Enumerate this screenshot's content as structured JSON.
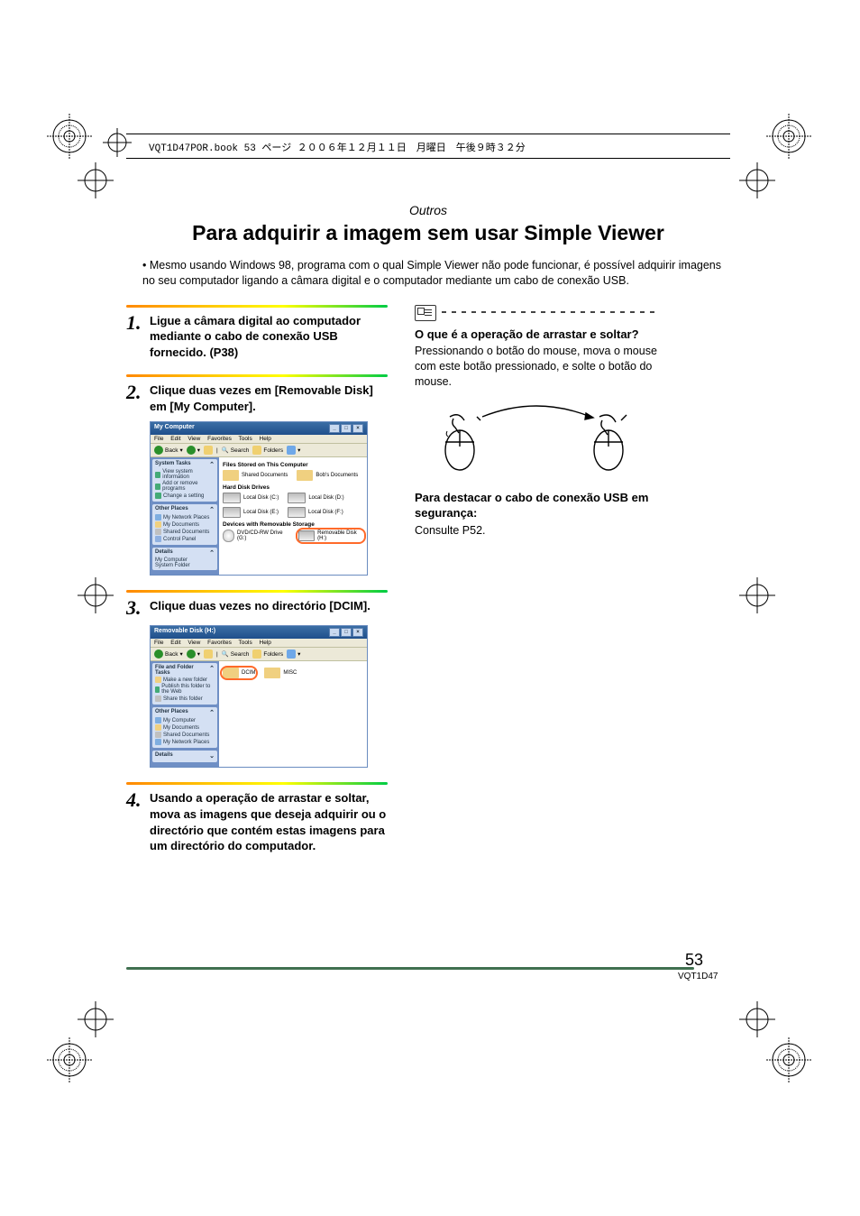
{
  "header_info": "VQT1D47POR.book  53 ページ  ２００６年１２月１１日　月曜日　午後９時３２分",
  "section_header": "Outros",
  "main_title": "Para adquirir a imagem sem usar Simple Viewer",
  "intro_text": "Mesmo usando Windows 98, programa com o qual Simple Viewer não pode funcionar, é possível adquirir imagens no seu computador ligando a câmara digital e o computador mediante um cabo de conexão USB.",
  "steps": [
    {
      "num": "1.",
      "text": "Ligue a câmara digital ao computador mediante o cabo de conexão USB fornecido. (P38)"
    },
    {
      "num": "2.",
      "text": "Clique duas vezes em [Removable Disk] em [My Computer]."
    },
    {
      "num": "3.",
      "text": "Clique duas vezes no directório [DCIM]."
    },
    {
      "num": "4.",
      "text": "Usando a operação de arrastar e soltar, mova as imagens que deseja adquirir ou o directório que contém estas imagens para um directório do computador."
    }
  ],
  "note": {
    "title": "O que é a operação de arrastar e soltar?",
    "body": "Pressionando o botão do mouse, mova o mouse com este botão pressionado, e solte o botão do mouse."
  },
  "usb_note": {
    "title": "Para destacar o cabo de conexão USB em segurança:",
    "body": "Consulte P52."
  },
  "page_number": "53",
  "doc_code": "VQT1D47",
  "screenshot1": {
    "title": "My Computer",
    "menu": [
      "File",
      "Edit",
      "View",
      "Favorites",
      "Tools",
      "Help"
    ],
    "toolbar": {
      "back": "Back",
      "search": "Search",
      "folders": "Folders"
    },
    "panes": {
      "system_tasks": {
        "hd": "System Tasks",
        "items": [
          "View system information",
          "Add or remove programs",
          "Change a setting"
        ]
      },
      "other_places": {
        "hd": "Other Places",
        "items": [
          "My Network Places",
          "My Documents",
          "Shared Documents",
          "Control Panel"
        ]
      },
      "details": {
        "hd": "Details",
        "items": [
          "My Computer",
          "System Folder"
        ]
      }
    },
    "sections": {
      "files_stored": {
        "hd": "Files Stored on This Computer",
        "items": [
          "Shared Documents",
          "Bob's Documents"
        ]
      },
      "hard_drives": {
        "hd": "Hard Disk Drives",
        "items": [
          "Local Disk (C:)",
          "Local Disk (D:)",
          "Local Disk (E:)",
          "Local Disk (F:)"
        ]
      },
      "removable": {
        "hd": "Devices with Removable Storage",
        "items": [
          "DVD/CD-RW Drive (G:)",
          "Removable Disk (H:)"
        ]
      }
    }
  },
  "screenshot2": {
    "title": "Removable Disk (H:)",
    "menu": [
      "File",
      "Edit",
      "View",
      "Favorites",
      "Tools",
      "Help"
    ],
    "toolbar": {
      "back": "Back",
      "search": "Search",
      "folders": "Folders"
    },
    "panes": {
      "file_tasks": {
        "hd": "File and Folder Tasks",
        "items": [
          "Make a new folder",
          "Publish this folder to the Web",
          "Share this folder"
        ]
      },
      "other_places": {
        "hd": "Other Places",
        "items": [
          "My Computer",
          "My Documents",
          "Shared Documents",
          "My Network Places"
        ]
      },
      "details": {
        "hd": "Details"
      }
    },
    "content_items": [
      "DCIM",
      "MISC"
    ]
  }
}
